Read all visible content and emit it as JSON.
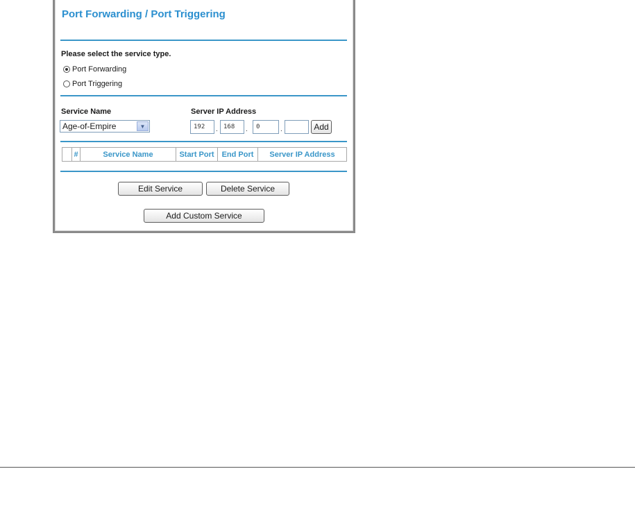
{
  "panel": {
    "title": "Port Forwarding / Port Triggering",
    "service_type_prompt": "Please select the service type.",
    "service_types": [
      {
        "label": "Port Forwarding",
        "checked": true
      },
      {
        "label": "Port Triggering",
        "checked": false
      }
    ],
    "service_name_label": "Service Name",
    "server_ip_label": "Server IP Address",
    "service_select": {
      "selected": "Age-of-Empire"
    },
    "ip_octets": [
      "192",
      "168",
      "0",
      ""
    ],
    "add_label": "Add",
    "table_columns": [
      "",
      "#",
      "Service Name",
      "Start Port",
      "End Port",
      "Server IP Address"
    ],
    "edit_label": "Edit Service",
    "delete_label": "Delete Service",
    "add_custom_label": "Add Custom Service"
  },
  "colors": {
    "accent": "#3a96c8",
    "title": "#2b8fcf"
  }
}
